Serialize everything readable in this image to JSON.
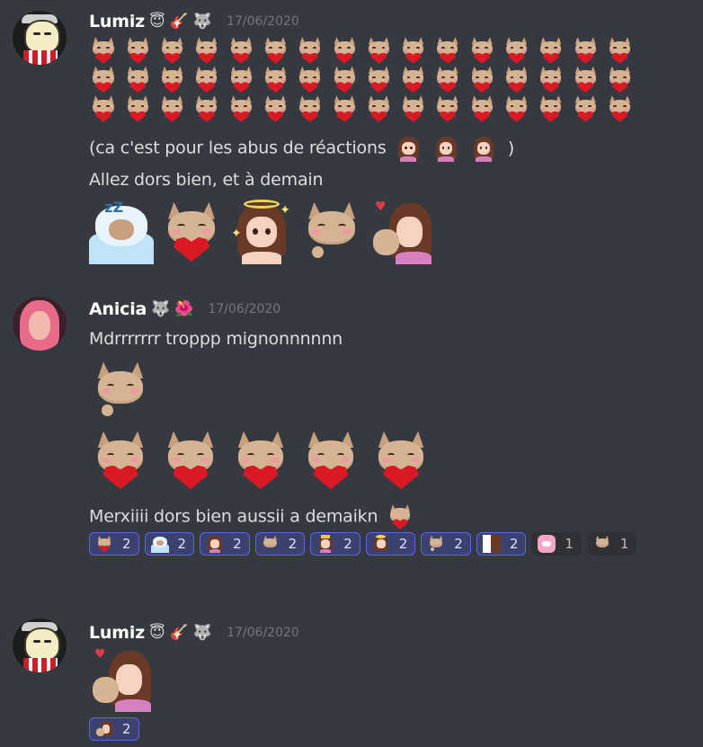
{
  "messages": [
    {
      "author": "Lumiz",
      "badges": [
        "😇",
        "🎸",
        "🐺"
      ],
      "timestamp": "17/06/2020",
      "lines": [
        "(ca c'est pour les abus de réactions",
        ")",
        "Allez dors bien, et à demain"
      ]
    },
    {
      "author": "Anicia",
      "badges": [
        "🐺",
        "🌺"
      ],
      "timestamp": "17/06/2020",
      "lines": [
        "Mdrrrrrrr troppp mignonnnnnn",
        "Merxiiii dors bien aussii a demaikn"
      ],
      "reactions": [
        {
          "emote": "cat-heart",
          "count": "2",
          "me": true
        },
        {
          "emote": "sleep",
          "count": "2",
          "me": true
        },
        {
          "emote": "girl",
          "count": "2",
          "me": true
        },
        {
          "emote": "cat",
          "count": "2",
          "me": true
        },
        {
          "emote": "crown-girl",
          "count": "2",
          "me": true
        },
        {
          "emote": "angel",
          "count": "2",
          "me": true
        },
        {
          "emote": "cat-wave",
          "count": "2",
          "me": true
        },
        {
          "emote": "peek",
          "count": "2",
          "me": true
        },
        {
          "emote": "pink-face",
          "count": "1",
          "me": false
        },
        {
          "emote": "cat-small",
          "count": "1",
          "me": false
        }
      ]
    },
    {
      "author": "Lumiz",
      "badges": [
        "😇",
        "🎸",
        "🐺"
      ],
      "timestamp": "17/06/2020",
      "reactions": [
        {
          "emote": "girl-cat",
          "count": "2",
          "me": true
        }
      ]
    }
  ]
}
